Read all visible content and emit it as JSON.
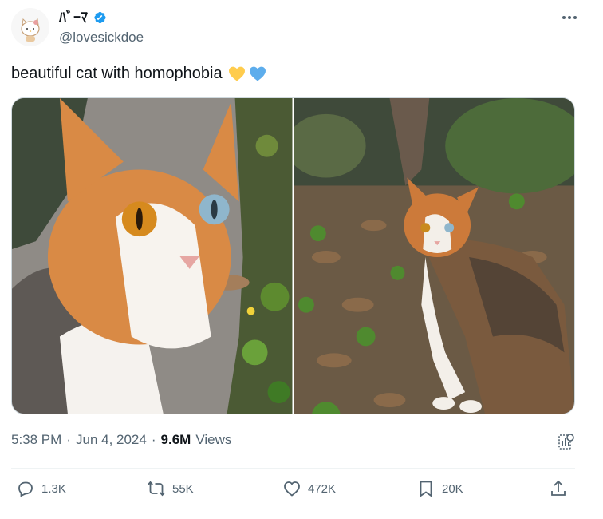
{
  "author": {
    "display_name": "ﾊﾞｰﾏ",
    "handle": "@lovesickdoe",
    "verified": true,
    "avatar_icon": "hello-kitty-avatar-icon"
  },
  "tweet": {
    "text": "beautiful cat with homophobia",
    "emojis": [
      "yellow-heart-icon",
      "blue-heart-icon"
    ]
  },
  "media": {
    "photos": [
      {
        "name": "cat-closeup-photo"
      },
      {
        "name": "cat-in-leaves-photo"
      }
    ]
  },
  "meta": {
    "time": "5:38 PM",
    "separator": "·",
    "date": "Jun 4, 2024",
    "views_count": "9.6M",
    "views_label": "Views"
  },
  "actions": {
    "replies": "1.3K",
    "reposts": "55K",
    "likes": "472K",
    "bookmarks": "20K"
  },
  "colors": {
    "text": "#0f1419",
    "muted": "#536471",
    "verified_blue": "#1d9bf0",
    "heart_yellow": "#ffcc4d",
    "heart_blue": "#5dadec"
  }
}
